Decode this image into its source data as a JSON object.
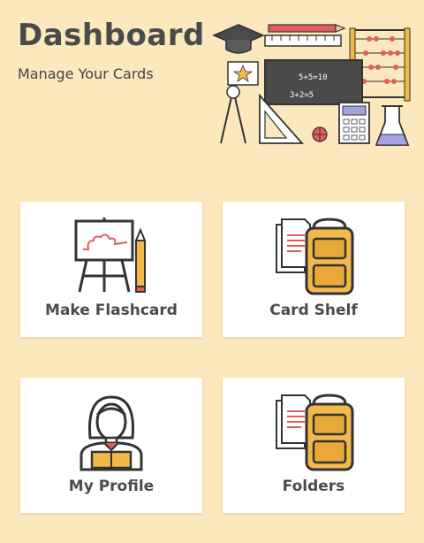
{
  "header": {
    "title": "Dashboard",
    "subtitle": "Manage Your Cards",
    "chalkboard_text": [
      "5+5=10",
      "3+2=5"
    ]
  },
  "cards": [
    {
      "label": "Make Flashcard",
      "icon": "presentation-board-icon"
    },
    {
      "label": "Card Shelf",
      "icon": "backpack-papers-icon"
    },
    {
      "label": "My Profile",
      "icon": "student-avatar-icon"
    },
    {
      "label": "Folders",
      "icon": "backpack-papers-icon"
    }
  ],
  "colors": {
    "background": "#fbe8bd",
    "card": "#ffffff",
    "accent_red": "#e35d5b",
    "accent_yellow": "#f2b94a",
    "outline": "#333333"
  }
}
